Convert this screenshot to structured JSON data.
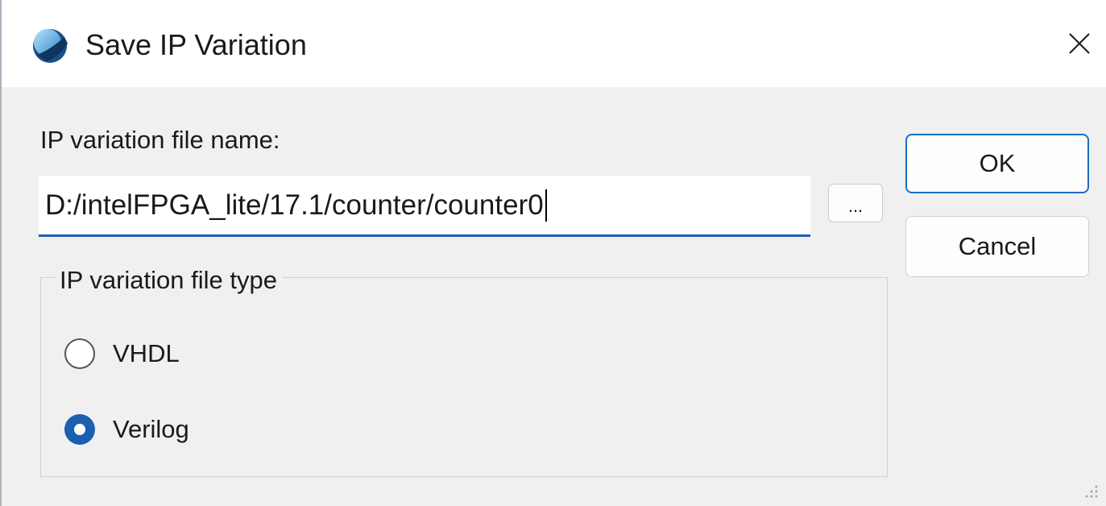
{
  "window": {
    "title": "Save IP Variation",
    "app_icon": "intel-quartus-icon",
    "close_icon": "close-icon"
  },
  "form": {
    "filename_label": "IP variation file name:",
    "filename_value": "D:/intelFPGA_lite/17.1/counter/counter0",
    "browse_label": "...",
    "filetype_group_label": "IP variation file type",
    "filetype_options": [
      {
        "label": "VHDL",
        "selected": false
      },
      {
        "label": "Verilog",
        "selected": true
      }
    ]
  },
  "buttons": {
    "ok_label": "OK",
    "cancel_label": "Cancel"
  },
  "colors": {
    "accent": "#1b5fb0",
    "input_underline": "#1d5fb1",
    "ok_border": "#1b6ec2",
    "titlebar": "#ffffff",
    "dialog_bg": "#f0f0f0"
  }
}
